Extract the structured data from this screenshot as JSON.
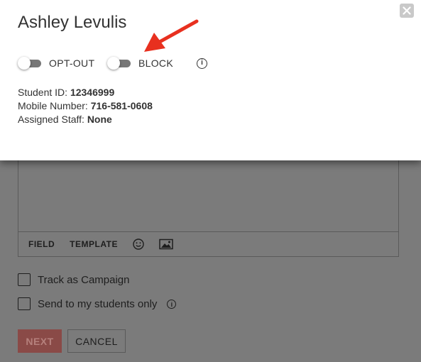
{
  "composer": {
    "toolbar": {
      "field_label": "FIELD",
      "template_label": "TEMPLATE",
      "emoji_icon": "smiley-icon",
      "image_icon": "image-icon"
    }
  },
  "options": {
    "track_campaign_label": "Track as Campaign",
    "send_to_my_students_label": "Send to my students only"
  },
  "actions": {
    "next_label": "NEXT",
    "cancel_label": "CANCEL"
  },
  "modal": {
    "title": "Ashley Levulis",
    "close_icon": "close-icon",
    "toggles": [
      {
        "label": "OPT-OUT",
        "on": false
      },
      {
        "label": "BLOCK",
        "on": false
      }
    ],
    "info_icon": "info-icon",
    "details": [
      {
        "label": "Student ID:",
        "value": "12346999"
      },
      {
        "label": "Mobile Number:",
        "value": "716-581-0608"
      },
      {
        "label": "Assigned Staff:",
        "value": "None"
      }
    ]
  },
  "annotation": {
    "arrow_color": "#e8301f"
  },
  "colors": {
    "overlay": "#7b7b7b",
    "next_button": "#8a4a47"
  }
}
